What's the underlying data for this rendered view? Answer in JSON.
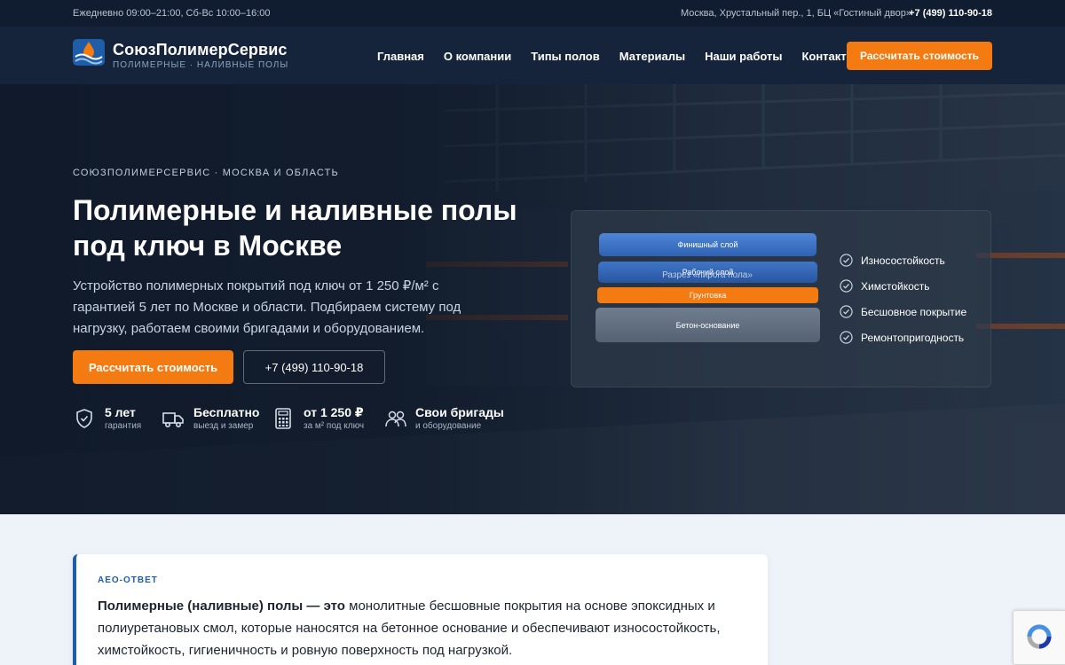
{
  "topbar": {
    "hours": "Ежедневно 09:00–21:00, Сб-Вс 10:00–16:00",
    "address": "Москва, Хрустальный пер., 1, БЦ «Гостиный двор»",
    "phone": "+7 (499) 110-90-18"
  },
  "header": {
    "brand_name": "СоюзПолимерСервис",
    "brand_tagline": "ПОЛИМЕРНЫЕ · НАЛИВНЫЕ ПОЛЫ",
    "nav": [
      "Главная",
      "О компании",
      "Типы полов",
      "Материалы",
      "Наши работы",
      "Контакты"
    ],
    "cta": "Рассчитать стоимость"
  },
  "hero": {
    "kicker": "СОЮЗПОЛИМЕРСЕРВИС · МОСКВА И ОБЛАСТЬ",
    "title": "Полимерные и наливные полы под ключ в Москве",
    "text": "Устройство полимерных покрытий под ключ от 1 250 ₽/м² с гарантией 5 лет по Москве и области. Подбираем систему под нагрузку, работаем своими бригадами и оборудованием.",
    "btn_primary": "Рассчитать стоимость",
    "btn_phone": "+7 (499) 110-90-18",
    "features": [
      {
        "icon": "shield-check-icon",
        "title": "5 лет",
        "sub": "гарантия"
      },
      {
        "icon": "truck-icon",
        "title": "Бесплатно",
        "sub": "выезд и замер"
      },
      {
        "icon": "calculator-icon",
        "title": "от 1 250 ₽",
        "sub": "за м² под ключ"
      },
      {
        "icon": "team-icon",
        "title": "Свои бригады",
        "sub": "и оборудование"
      }
    ]
  },
  "layers": {
    "items": [
      "Финишный слой",
      "Рабочий слой",
      "Грунтовка",
      "Бетон-основание"
    ],
    "caption": "Разрез «пирога пола»",
    "properties": [
      "Износостойкость",
      "Химстойкость",
      "Бесшовное покрытие",
      "Ремонтопригодность"
    ]
  },
  "aeo": {
    "tag": "AEO-ОТВЕТ",
    "lead": "Полимерные (наливные) полы — это",
    "text": " монолитные бесшовные покрытия на основе эпоксидных и полиуретановых смол, которые наносятся на бетонное основание и обеспечивают износостойкость, химстойкость, гигиеничность и ровную поверхность под нагрузкой."
  },
  "colors": {
    "accent": "#f47a12",
    "brand_blue": "#1e5ea8",
    "dark": "#101d30"
  }
}
